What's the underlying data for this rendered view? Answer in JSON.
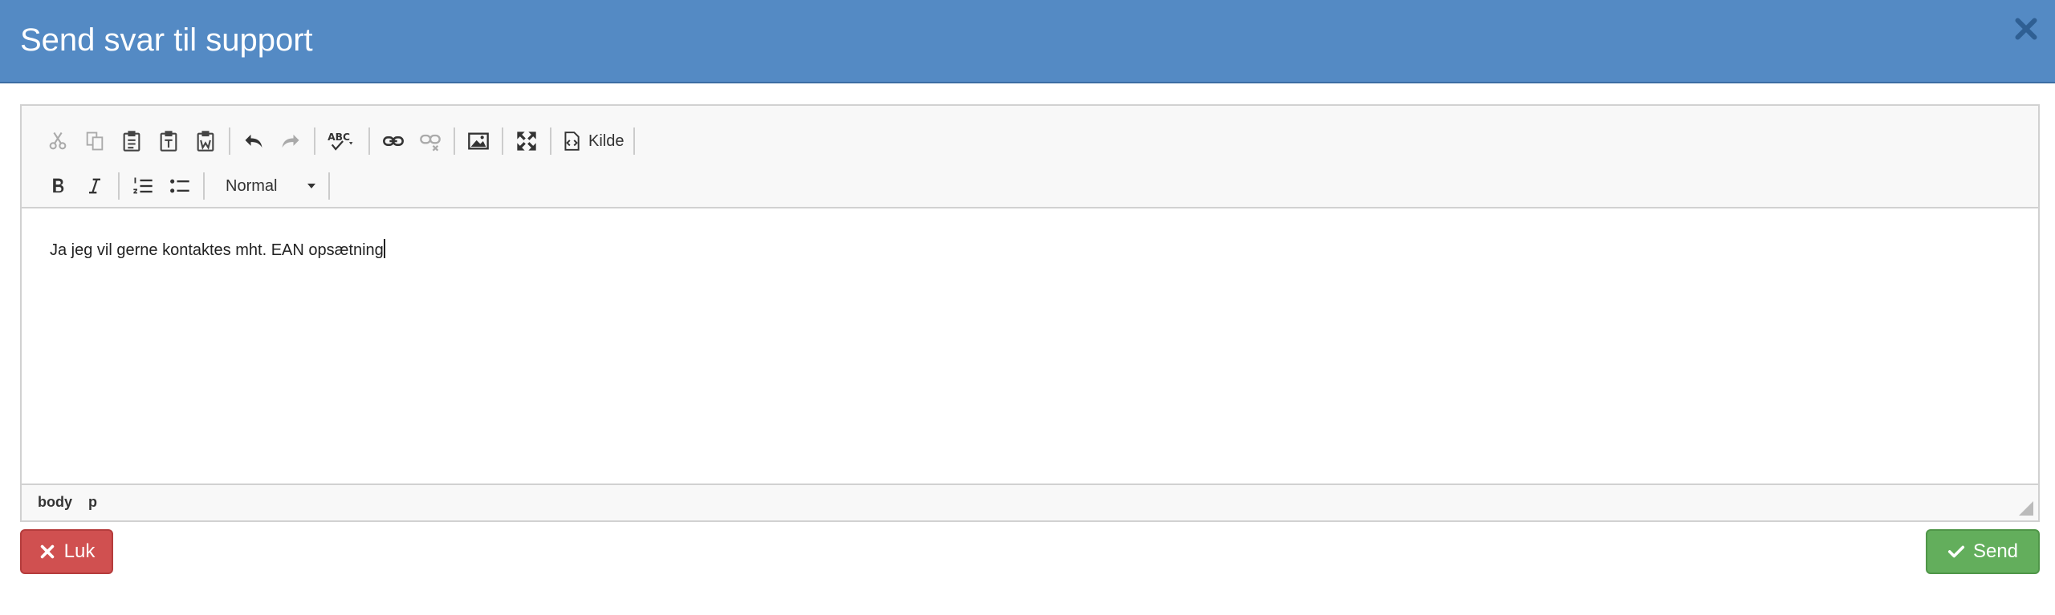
{
  "dialog": {
    "title": "Send svar til support",
    "close_icon": "close-icon"
  },
  "toolbar": {
    "row1": [
      "cut-icon",
      "copy-icon",
      "paste-icon",
      "paste-text-icon",
      "paste-word-icon",
      "undo-icon",
      "redo-icon",
      "spellcheck-icon",
      "link-icon",
      "unlink-icon",
      "image-icon",
      "maximize-icon",
      "source-icon"
    ],
    "source_label": "Kilde",
    "row2": [
      "bold-icon",
      "italic-icon",
      "numbered-list-icon",
      "bulleted-list-icon"
    ],
    "format_value": "Normal",
    "spell_abc": "ABC"
  },
  "editor": {
    "content": "Ja jeg vil gerne kontaktes mht. EAN opsætning"
  },
  "statusbar": {
    "path": [
      "body",
      "p"
    ]
  },
  "buttons": {
    "close_label": "Luk",
    "send_label": "Send"
  },
  "colors": {
    "header": "#548ac4",
    "danger": "#d05050",
    "success": "#63ae5c"
  }
}
